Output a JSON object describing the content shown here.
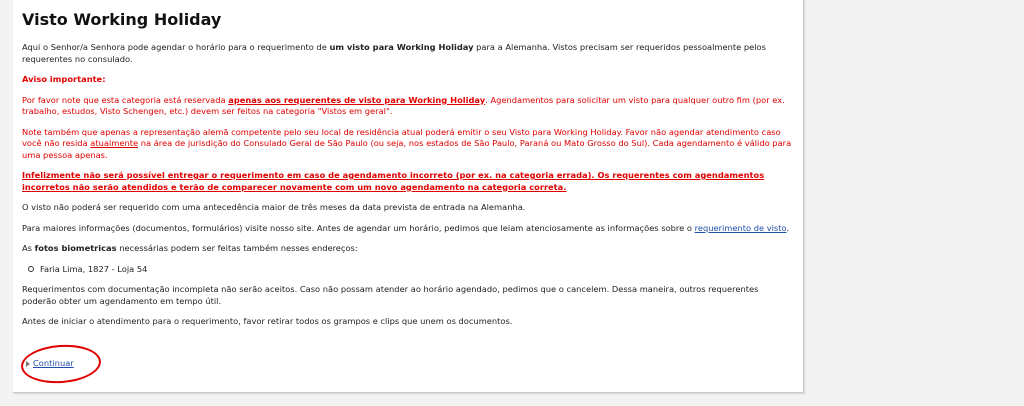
{
  "title": "Visto Working Holiday",
  "intro": {
    "part1": "Aqui o Senhor/a Senhora pode agendar o horário para o requerimento de ",
    "bold": "um visto para Working Holiday",
    "part2": " para a Alemanha. Vistos precisam ser requeridos pessoalmente pelos requerentes no consulado."
  },
  "warning_heading": "Aviso importante:",
  "warning1": {
    "part1": "Por favor note que esta categoria está reservada ",
    "emph": "apenas aos requerentes de visto para Working Holiday",
    "part2": ". Agendamentos para solicitar um visto para qualquer outro fim (por ex. trabalho, estudos, Visto Schengen, etc.) devem ser feitos na categoria \"Vistos em geral\"."
  },
  "warning2": {
    "part1": "Note também que apenas a representação alemã competente pelo seu local de residência atual poderá emitir o seu Visto para Working Holiday. Favor não agendar atendimento caso você não resida ",
    "emph": "atualmente",
    "part2": " na área de jurisdição do Consulado Geral de São Paulo (ou seja, nos estados de São Paulo, Paraná ou Mato Grosso do Sul). Cada agendamento é válido para uma pessoa apenas."
  },
  "warning3": "Infelizmente não será possível entregar o requerimento em caso de agendamento incorreto (por ex. na categoria errada). Os requerentes com agendamentos incorretos não serão atendidos e terão de comparecer novamente com um novo agendamento na categoria correta.",
  "timing": "O visto não poderá ser requerido com uma antecedência maior de três meses da data prevista de entrada na Alemanha.",
  "info": {
    "part1": "Para maiores informações (documentos, formulários) visite nosso site. Antes de agendar um horário, pedimos que leiam atenciosamente as informações sobre o ",
    "link": "requerimento de visto",
    "part2": "."
  },
  "photos": {
    "part1": "As ",
    "bold": "fotos biometricas",
    "part2": " necessárias podem ser feitas também nesses endereços:"
  },
  "addresses": [
    "Faria Lima, 1827 - Loja 54"
  ],
  "incomplete": "Requerimentos com documentação incompleta não serão aceitos. Caso não possam atender ao horário agendado, pedimos que o cancelem. Dessa maneira, outros requerentes poderão obter um agendamento em tempo útil.",
  "clips": "Antes de iniciar o atendimento para o requerimento, favor retirar todos os grampos e clips que unem os documentos.",
  "continue_label": "Continuar"
}
